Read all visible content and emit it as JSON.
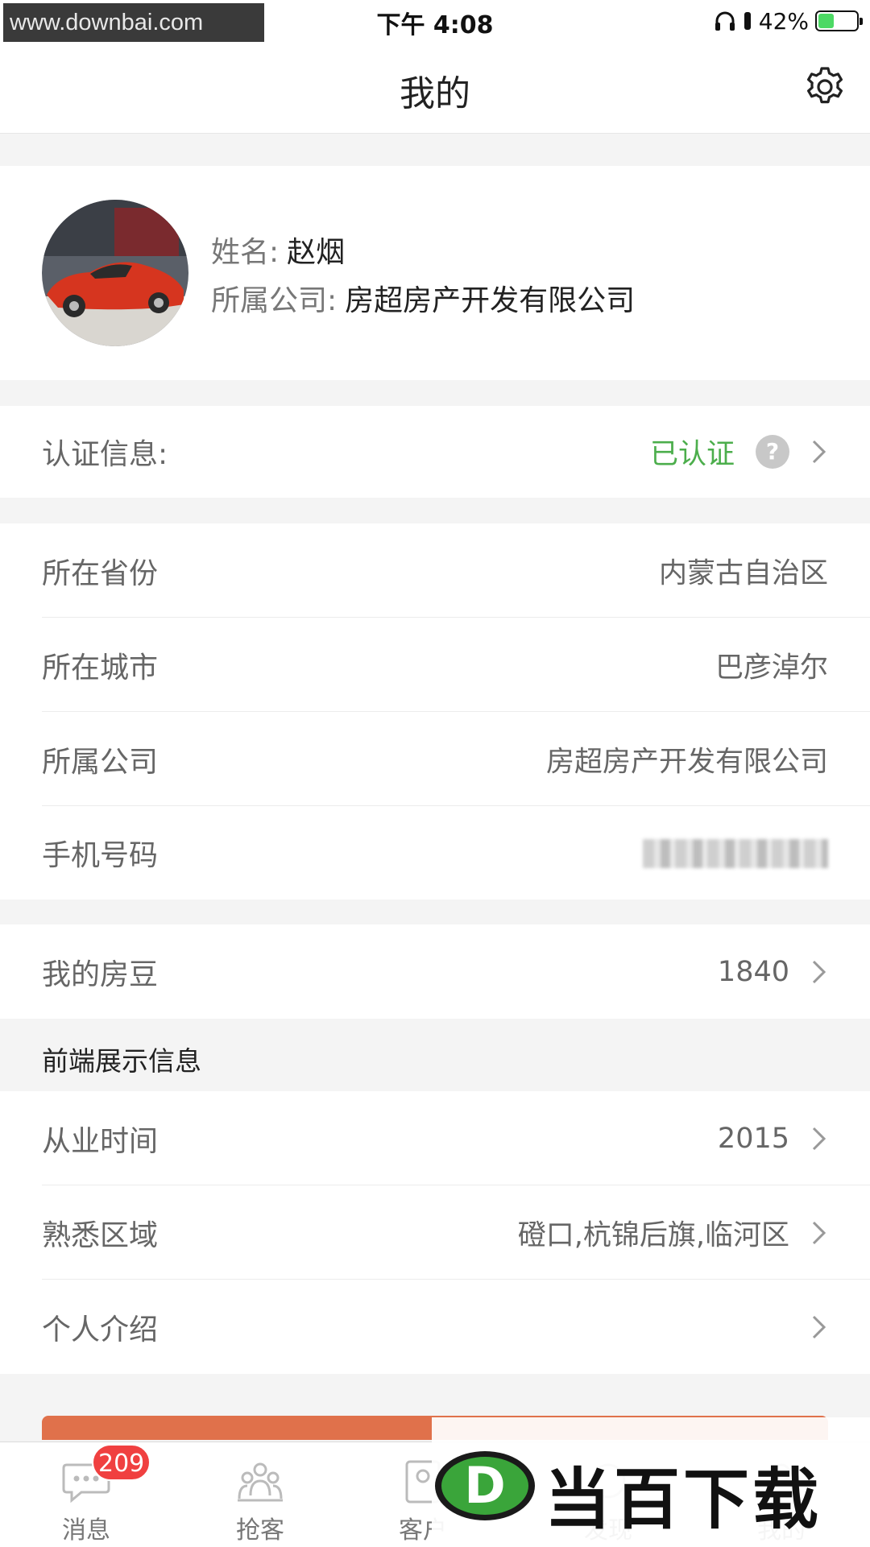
{
  "status_bar": {
    "watermark": "www.downbai.com",
    "time": "下午 4:08",
    "battery_percent": "42%",
    "battery_level": 0.42
  },
  "nav": {
    "title": "我的"
  },
  "profile": {
    "name_label": "姓名:",
    "name": "赵烟",
    "company_label": "所属公司:",
    "company": "房超房产开发有限公司"
  },
  "certification": {
    "label": "认证信息:",
    "status": "已认证",
    "help": "?"
  },
  "info_rows": [
    {
      "label": "所在省份",
      "value": "内蒙古自治区"
    },
    {
      "label": "所在城市",
      "value": "巴彦淖尔"
    },
    {
      "label": "所属公司",
      "value": "房超房产开发有限公司"
    },
    {
      "label": "手机号码",
      "value": ""
    }
  ],
  "beans": {
    "label": "我的房豆",
    "value": "1840"
  },
  "section_header": "前端展示信息",
  "display_rows": [
    {
      "label": "从业时间",
      "value": "2015"
    },
    {
      "label": "熟悉区域",
      "value": "磴口,杭锦后旗,临河区"
    },
    {
      "label": "个人介绍",
      "value": ""
    }
  ],
  "tab_bar": {
    "tabs": [
      {
        "label": "消息",
        "badge": "209",
        "icon": "message-bubble-icon"
      },
      {
        "label": "抢客",
        "icon": "people-group-icon"
      },
      {
        "label": "客户",
        "icon": "contact-card-icon"
      },
      {
        "label": "发现",
        "icon": "discover-icon"
      },
      {
        "label": "我的",
        "icon": "profile-icon"
      }
    ]
  },
  "brand_watermark": {
    "text": "当百下载",
    "logo_letter": "D"
  },
  "colors": {
    "verified_green": "#4cae4c",
    "badge_red": "#f04040",
    "cta_orange": "#e0714b"
  }
}
